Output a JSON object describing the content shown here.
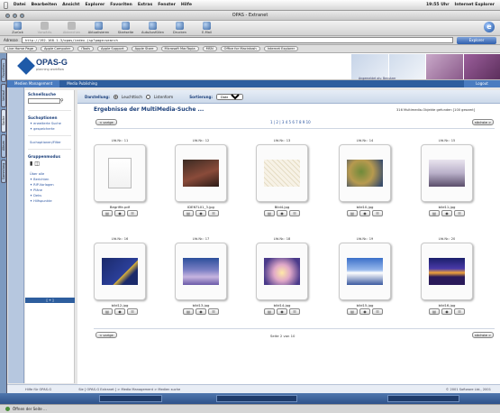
{
  "system_menu": {
    "items": [
      "Datei",
      "Bearbeiten",
      "Ansicht",
      "Explorer",
      "Favoriten",
      "Extras",
      "Fenster",
      "Hilfe"
    ],
    "clock": "19:55 Uhr",
    "connection": "Internet Explorer"
  },
  "window": {
    "title": "OPAS - Extranet"
  },
  "toolbar": {
    "buttons": [
      "Zurück",
      "Vorwärts",
      "Abbrechen",
      "Aktualisieren",
      "Startseite",
      "AutoAusfüllen",
      "Drucken",
      "E-Mail"
    ]
  },
  "address": {
    "label": "Adresse",
    "url": "http://192.168.1.3/opas/index.jsp?page=search",
    "go_label": "Explorer"
  },
  "favorites": [
    "Live Home Page",
    "Apple Computer",
    "iTools",
    "Apple Support",
    "Apple Store",
    "Microsoft MacTopia",
    "MSN",
    "Office for Macintosh",
    "Internet Explorer"
  ],
  "left_tabs": [
    "Favoriten",
    "Verlauf",
    "Suche",
    "Album",
    "Sammlung"
  ],
  "brand": {
    "name": "OPAS-G",
    "tagline": "planning workflow"
  },
  "header_note": "Angemeldet als: Benutzer",
  "nav": {
    "tabs": [
      "Medien Management",
      "Media Publishing"
    ],
    "logout": "Logout"
  },
  "sidebar": {
    "schnellsuche": "Schnellsuche",
    "suchoptionen": "Suchoptionen",
    "opt1": "erweiterte Suche",
    "opt2": "gespeicherte",
    "filter": "Suchoptionen/Filter",
    "gruppen": "Gruppenmodus",
    "links": [
      "Über alle",
      "Berichten",
      "RIP-Vorlagen",
      "Pläne",
      "Deks",
      "Hilfspunkte"
    ],
    "footer": "[ + ]"
  },
  "main": {
    "darstellung_label": "Darstellung:",
    "opt_leuchttisch": "Leuchttisch",
    "opt_listen": "Listenform",
    "sort_label": "Sortierung:",
    "sort_value": "Dateiname",
    "title": "Ergebnisse der MultiMedia-Suche ...",
    "count": "316 Multimedia-Objekte gefunden [100 gesamt]",
    "pages": "1 | 2 | 3 4 5 6 7 8 9 10",
    "prev": "< vorige",
    "next": "nächste >",
    "page_info": "Seite 2 von 10"
  },
  "cards": [
    {
      "id": "Lfd.Nr.: 11",
      "name": "Begriffe.pdf",
      "art": "doc"
    },
    {
      "id": "Lfd.Nr.: 12",
      "name": "IDENTL01_3.jpg",
      "art": "room"
    },
    {
      "id": "Lfd.Nr.: 13",
      "name": "Bild4.jpg",
      "art": "sketch"
    },
    {
      "id": "Lfd.Nr.: 14",
      "name": "bild10.jpg",
      "art": "map"
    },
    {
      "id": "Lfd.Nr.: 15",
      "name": "bild11.jpg",
      "art": "winter"
    },
    {
      "id": "Lfd.Nr.: 16",
      "name": "bild12.jpg",
      "art": "stars"
    },
    {
      "id": "Lfd.Nr.: 17",
      "name": "bild13.jpg",
      "art": "purple"
    },
    {
      "id": "Lfd.Nr.: 18",
      "name": "bild14.jpg",
      "art": "glow"
    },
    {
      "id": "Lfd.Nr.: 19",
      "name": "bild15.jpg",
      "art": "sky"
    },
    {
      "id": "Lfd.Nr.: 20",
      "name": "bild16.jpg",
      "art": "sunset"
    }
  ],
  "footer": {
    "left": "Hilfe für OPAS-G",
    "crumb": "Sie [ OPAS-G Extranet ] > Media Management > Medien suche",
    "right": "© 2001 Software Ltd., 2001"
  },
  "status": {
    "text": "Öffnen der Seite ..."
  }
}
